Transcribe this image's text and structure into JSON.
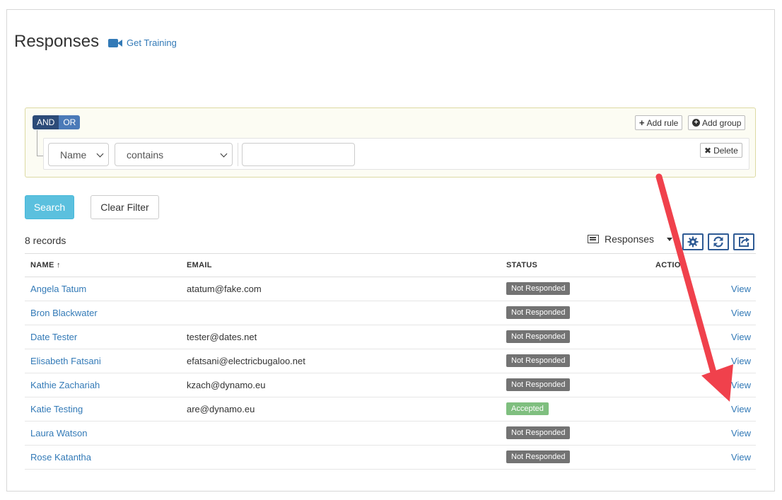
{
  "page": {
    "title": "Responses",
    "training_label": "Get Training"
  },
  "query_builder": {
    "and_label": "AND",
    "or_label": "OR",
    "add_rule_label": "Add rule",
    "add_group_label": "Add group",
    "field_value": "Name",
    "operator_value": "contains",
    "input_value": "",
    "delete_label": "Delete"
  },
  "actions": {
    "search_label": "Search",
    "clear_label": "Clear Filter"
  },
  "toolbar": {
    "records_count": "8 records",
    "view_label": "Responses"
  },
  "table": {
    "columns": [
      "NAME ↑",
      "EMAIL",
      "STATUS",
      "ACTION"
    ],
    "rows": [
      {
        "name": "Angela Tatum",
        "email": "atatum@fake.com",
        "status": "Not Responded",
        "action": "View"
      },
      {
        "name": "Bron Blackwater",
        "email": "",
        "status": "Not Responded",
        "action": "View"
      },
      {
        "name": "Date Tester",
        "email": "tester@dates.net",
        "status": "Not Responded",
        "action": "View"
      },
      {
        "name": "Elisabeth Fatsani",
        "email": "efatsani@electricbugaloo.net",
        "status": "Not Responded",
        "action": "View"
      },
      {
        "name": "Kathie Zachariah",
        "email": "kzach@dynamo.eu",
        "status": "Not Responded",
        "action": "View"
      },
      {
        "name": "Katie Testing",
        "email": "are@dynamo.eu",
        "status": "Accepted",
        "action": "View"
      },
      {
        "name": "Laura Watson",
        "email": "",
        "status": "Not Responded",
        "action": "View"
      },
      {
        "name": "Rose Katantha",
        "email": "",
        "status": "Not Responded",
        "action": "View"
      }
    ]
  },
  "colors": {
    "link": "#337ab7",
    "search_button": "#5bc0de",
    "accepted_badge": "#7fbf7f",
    "not_responded_badge": "#737373",
    "annotation_arrow": "#f0414c"
  },
  "icons": [
    "video-camera-icon",
    "plus-icon",
    "plus-circle-icon",
    "x-icon",
    "list-icon",
    "gear-icon",
    "refresh-icon",
    "export-icon"
  ]
}
